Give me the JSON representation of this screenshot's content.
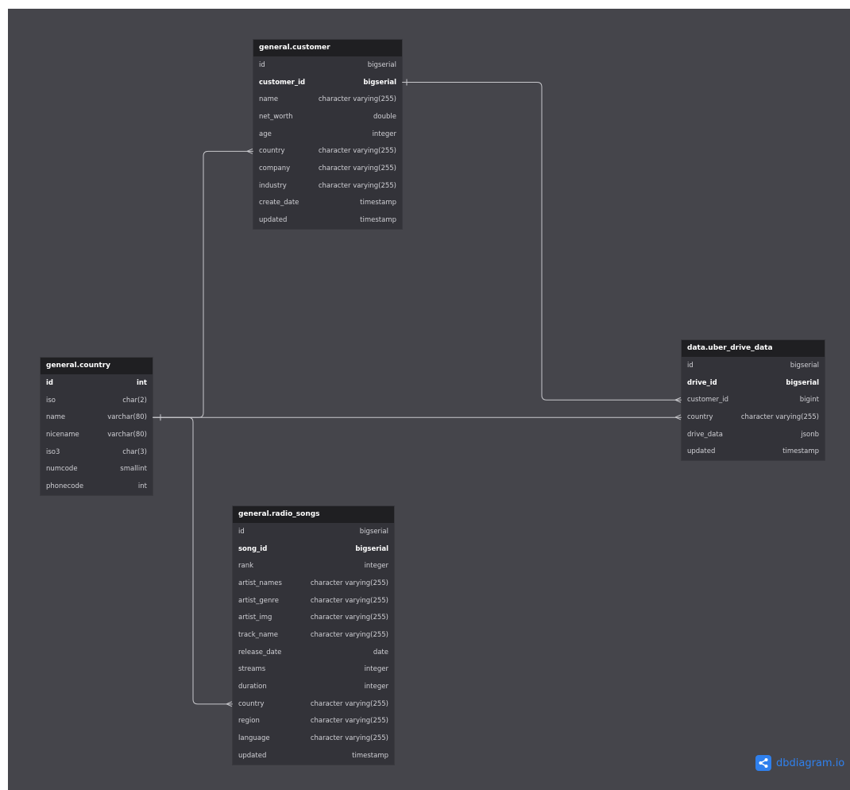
{
  "tables": [
    {
      "id": "customer",
      "name": "general.customer",
      "fields": [
        {
          "name": "id",
          "type": "bigserial"
        },
        {
          "name": "customer_id",
          "type": "bigserial",
          "pk": true
        },
        {
          "name": "name",
          "type": "character varying(255)"
        },
        {
          "name": "net_worth",
          "type": "double"
        },
        {
          "name": "age",
          "type": "integer"
        },
        {
          "name": "country",
          "type": "character varying(255)"
        },
        {
          "name": "company",
          "type": "character varying(255)"
        },
        {
          "name": "industry",
          "type": "character varying(255)"
        },
        {
          "name": "create_date",
          "type": "timestamp"
        },
        {
          "name": "updated",
          "type": "timestamp"
        }
      ]
    },
    {
      "id": "country",
      "name": "general.country",
      "fields": [
        {
          "name": "id",
          "type": "int",
          "pk": true
        },
        {
          "name": "iso",
          "type": "char(2)"
        },
        {
          "name": "name",
          "type": "varchar(80)"
        },
        {
          "name": "nicename",
          "type": "varchar(80)"
        },
        {
          "name": "iso3",
          "type": "char(3)"
        },
        {
          "name": "numcode",
          "type": "smallint"
        },
        {
          "name": "phonecode",
          "type": "int"
        }
      ]
    },
    {
      "id": "uber",
      "name": "data.uber_drive_data",
      "fields": [
        {
          "name": "id",
          "type": "bigserial"
        },
        {
          "name": "drive_id",
          "type": "bigserial",
          "pk": true
        },
        {
          "name": "customer_id",
          "type": "bigint"
        },
        {
          "name": "country",
          "type": "character varying(255)"
        },
        {
          "name": "drive_data",
          "type": "jsonb"
        },
        {
          "name": "updated",
          "type": "timestamp"
        }
      ]
    },
    {
      "id": "radio",
      "name": "general.radio_songs",
      "fields": [
        {
          "name": "id",
          "type": "bigserial"
        },
        {
          "name": "song_id",
          "type": "bigserial",
          "pk": true
        },
        {
          "name": "rank",
          "type": "integer"
        },
        {
          "name": "artist_names",
          "type": "character varying(255)"
        },
        {
          "name": "artist_genre",
          "type": "character varying(255)"
        },
        {
          "name": "artist_img",
          "type": "character varying(255)"
        },
        {
          "name": "track_name",
          "type": "character varying(255)"
        },
        {
          "name": "release_date",
          "type": "date"
        },
        {
          "name": "streams",
          "type": "integer"
        },
        {
          "name": "duration",
          "type": "integer"
        },
        {
          "name": "country",
          "type": "character varying(255)"
        },
        {
          "name": "region",
          "type": "character varying(255)"
        },
        {
          "name": "language",
          "type": "character varying(255)"
        },
        {
          "name": "updated",
          "type": "timestamp"
        }
      ]
    }
  ],
  "relations": [
    {
      "from": "customer.customer_id",
      "to": "uber.customer_id"
    },
    {
      "from": "country.name",
      "to": "customer.country"
    },
    {
      "from": "country.name",
      "to": "uber.country"
    },
    {
      "from": "country.name",
      "to": "radio.country"
    }
  ],
  "brand": {
    "text": "dbdiagram.io",
    "color": "#2f80ed"
  },
  "colors": {
    "canvas": "#45454b",
    "table_body": "#333339",
    "table_header": "#1f1f22",
    "edge": "#c8c8cc"
  }
}
